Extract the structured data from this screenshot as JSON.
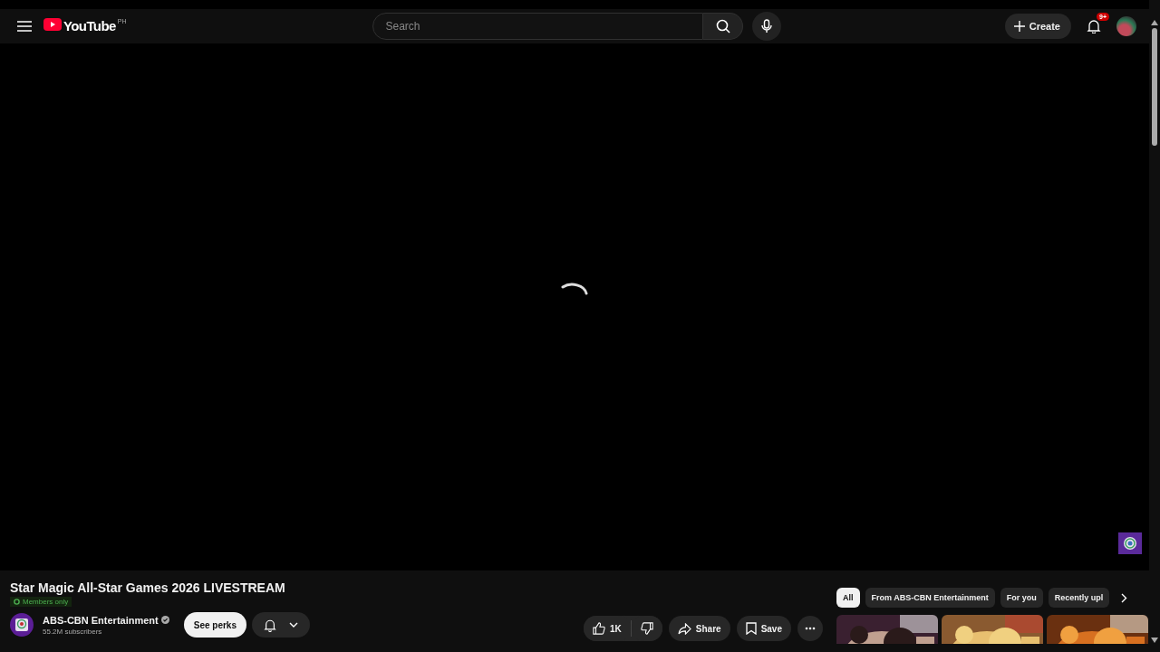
{
  "header": {
    "logo_text": "YouTube",
    "country_code": "PH",
    "search": {
      "placeholder": "Search"
    },
    "create_label": "Create",
    "notification_count": "9+"
  },
  "video": {
    "title": "Star Magic All-Star Games 2026 LIVESTREAM",
    "members_badge": "Members only",
    "channel": {
      "name": "ABS-CBN Entertainment",
      "subscribers": "55.2M subscribers",
      "verified": true
    },
    "perks_label": "See perks",
    "likes": "1K",
    "share_label": "Share",
    "save_label": "Save"
  },
  "chips": [
    {
      "label": "All",
      "selected": true
    },
    {
      "label": "From ABS-CBN Entertainment",
      "selected": false
    },
    {
      "label": "For you",
      "selected": false
    },
    {
      "label": "Recently upl",
      "selected": false
    }
  ]
}
